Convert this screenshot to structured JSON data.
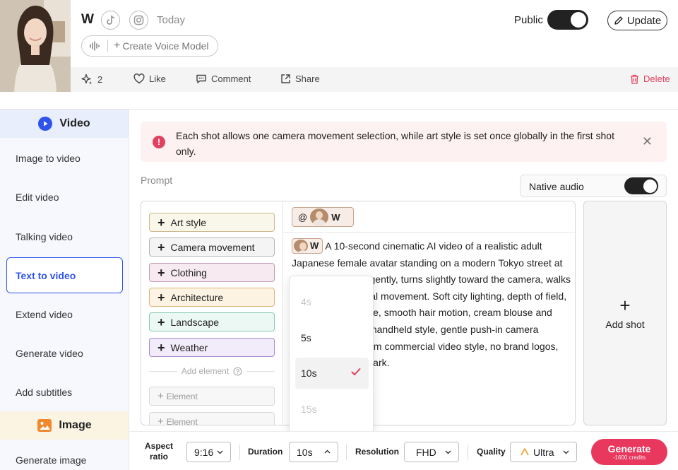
{
  "header": {
    "user_name": "W",
    "date": "Today",
    "voice_button": "Create Voice Model",
    "public_label": "Public",
    "update_label": "Update"
  },
  "actions": {
    "spark_count": "2",
    "like": "Like",
    "comment": "Comment",
    "share": "Share",
    "delete": "Delete"
  },
  "sidebar": {
    "video_section": "Video",
    "items": [
      {
        "label": "Image to video"
      },
      {
        "label": "Edit video"
      },
      {
        "label": "Talking video"
      },
      {
        "label": "Text to video"
      },
      {
        "label": "Extend video"
      },
      {
        "label": "Generate video"
      },
      {
        "label": "Add subtitles"
      }
    ],
    "image_section": "Image",
    "image_items": [
      {
        "label": "Generate image"
      }
    ]
  },
  "notice": {
    "text": "Each shot allows one camera movement selection, while art style is set once globally in the first shot only."
  },
  "prompt": {
    "label": "Prompt",
    "native_audio_label": "Native audio",
    "mention_at": "@",
    "mention_name": "W",
    "inline_name": "W",
    "text": "A 10-second cinematic AI video of a realistic adult Japanese female avatar standing on a modern Tokyo street at night. She smiles gently, turns slightly toward the camera, walks forward with natural movement. Soft city lighting, depth of field, realistic skin texture, smooth hair motion, cream blouse and light beige blazer, handheld style, gentle push-in camera movement, premium commercial video style, no brand logos, no text, no watermark."
  },
  "elements": {
    "chips": [
      {
        "label": "Art style",
        "color": "#f9f6ea",
        "border": "#c9b98c"
      },
      {
        "label": "Camera movement",
        "color": "#f4f4f4",
        "border": "#b5b5b5"
      },
      {
        "label": "Clothing",
        "color": "#f7eaf1",
        "border": "#c39ab1"
      },
      {
        "label": "Architecture",
        "color": "#fdf3e3",
        "border": "#d9b57a"
      },
      {
        "label": "Landscape",
        "color": "#ecf8f4",
        "border": "#86c7b3"
      },
      {
        "label": "Weather",
        "color": "#f2ebfa",
        "border": "#a98bcd"
      }
    ],
    "add_element_label": "Add element",
    "element_placeholders": [
      {
        "label": "Element"
      },
      {
        "label": "Element"
      }
    ]
  },
  "add_shot_label": "Add shot",
  "duration_options": [
    {
      "label": "4s",
      "disabled": true
    },
    {
      "label": "5s",
      "disabled": false
    },
    {
      "label": "10s",
      "disabled": false,
      "selected": true
    },
    {
      "label": "15s",
      "disabled": true
    }
  ],
  "bottom": {
    "aspect_label_1": "Aspect",
    "aspect_label_2": "ratio",
    "aspect_value": "9:16",
    "duration_label": "Duration",
    "duration_value": "10s",
    "resolution_label": "Resolution",
    "resolution_value": "FHD",
    "quality_label": "Quality",
    "quality_value": "Ultra",
    "generate_label": "Generate",
    "generate_credits": "-1600 credits"
  },
  "colors": {
    "accent_blue": "#2f54eb",
    "accent_red": "#e8385e",
    "toggle_on": "#222222"
  }
}
